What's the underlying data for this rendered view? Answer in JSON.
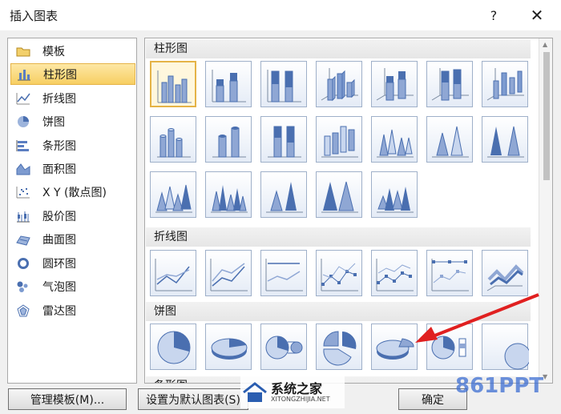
{
  "window": {
    "title": "插入图表",
    "help_label": "?",
    "close_label": "✕"
  },
  "sidebar": {
    "items": [
      {
        "label": "模板",
        "icon": "folder-icon"
      },
      {
        "label": "柱形图",
        "icon": "column-chart-icon",
        "selected": true
      },
      {
        "label": "折线图",
        "icon": "line-chart-icon"
      },
      {
        "label": "饼图",
        "icon": "pie-chart-icon"
      },
      {
        "label": "条形图",
        "icon": "bar-chart-icon"
      },
      {
        "label": "面积图",
        "icon": "area-chart-icon"
      },
      {
        "label": "X Y (散点图)",
        "icon": "scatter-chart-icon"
      },
      {
        "label": "股价图",
        "icon": "stock-chart-icon"
      },
      {
        "label": "曲面图",
        "icon": "surface-chart-icon"
      },
      {
        "label": "圆环图",
        "icon": "doughnut-chart-icon"
      },
      {
        "label": "气泡图",
        "icon": "bubble-chart-icon"
      },
      {
        "label": "雷达图",
        "icon": "radar-chart-icon"
      }
    ]
  },
  "sections": {
    "column": "柱形图",
    "line": "折线图",
    "pie": "饼图",
    "bar_partial": "条形图"
  },
  "buttons": {
    "manage": "管理模板(M)...",
    "set_default": "设置为默认图表(S)",
    "ok": "确定"
  },
  "watermark": {
    "left_brand": "系统之家",
    "left_url": "XITONGZHIJIA.NET",
    "right_brand": "861PPT"
  },
  "colors": {
    "accent": "#f7cf62",
    "chart_blue": "#4a6fb0",
    "annotation_red": "#e02020"
  }
}
